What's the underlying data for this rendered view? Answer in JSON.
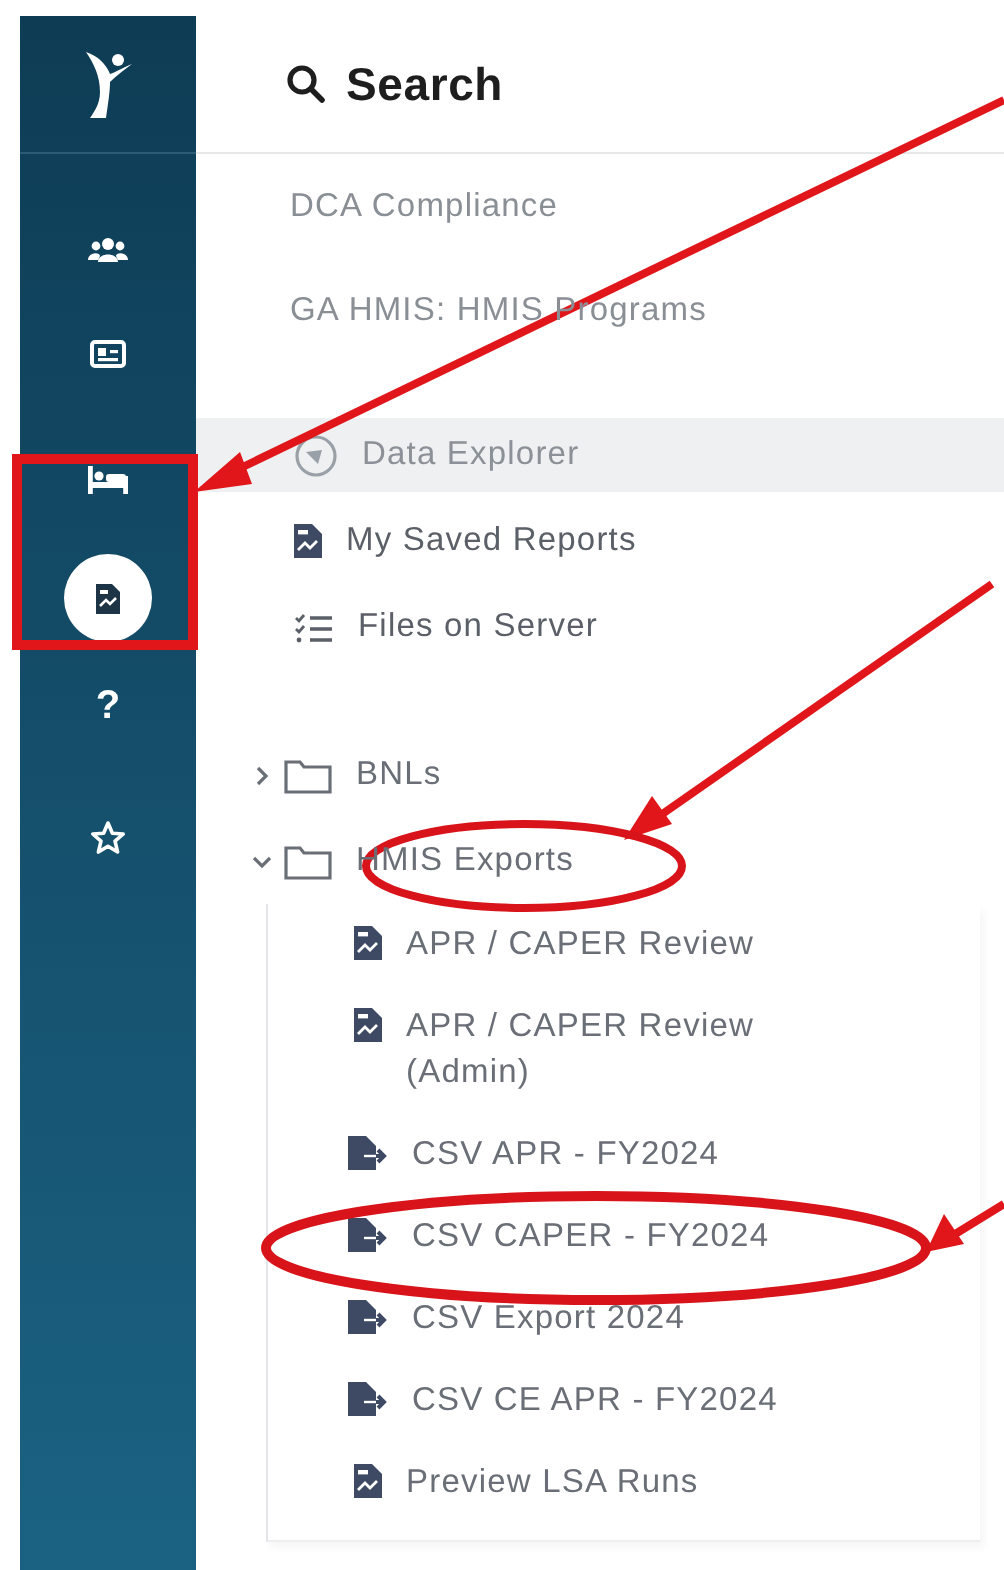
{
  "rail": {
    "items": [
      {
        "kind": "people",
        "selected": false
      },
      {
        "kind": "card",
        "selected": false
      },
      {
        "kind": "bed",
        "selected": false
      },
      {
        "kind": "reports",
        "selected": true
      },
      {
        "kind": "help",
        "glyph": "?",
        "selected": false
      },
      {
        "kind": "star",
        "selected": false
      }
    ]
  },
  "header": {
    "title": "Search"
  },
  "links": [
    {
      "label": "DCA Compliance"
    },
    {
      "label": "GA HMIS: HMIS Programs"
    }
  ],
  "menu": [
    {
      "label": "Data Explorer",
      "kind": "explorer",
      "selected": true
    },
    {
      "label": "My Saved Reports",
      "kind": "report",
      "selected": false
    },
    {
      "label": "Files on Server",
      "kind": "list",
      "selected": false
    }
  ],
  "folders": [
    {
      "label": "BNLs",
      "expanded": false
    },
    {
      "label": "HMIS Exports",
      "expanded": true,
      "children": [
        {
          "label": "APR / CAPER Review",
          "kind": "report"
        },
        {
          "label": "APR / CAPER Review (Admin)",
          "kind": "report"
        },
        {
          "label": "CSV APR - FY2024",
          "kind": "export"
        },
        {
          "label": "CSV CAPER - FY2024",
          "kind": "export"
        },
        {
          "label": "CSV Export 2024",
          "kind": "export"
        },
        {
          "label": "CSV CE APR - FY2024",
          "kind": "export"
        },
        {
          "label": "Preview LSA Runs",
          "kind": "report"
        }
      ]
    }
  ]
}
